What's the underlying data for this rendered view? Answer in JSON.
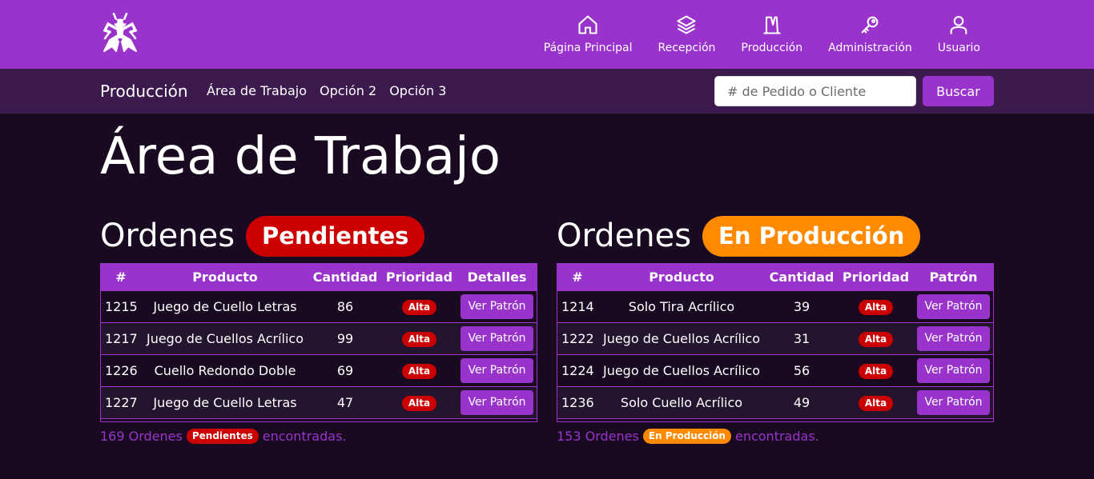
{
  "nav": [
    {
      "label": "Página Principal",
      "icon": "home-icon"
    },
    {
      "label": "Recepción",
      "icon": "layers-icon"
    },
    {
      "label": "Producción",
      "icon": "production-icon"
    },
    {
      "label": "Administración",
      "icon": "key-icon"
    },
    {
      "label": "Usuario",
      "icon": "user-icon"
    }
  ],
  "subbar": {
    "brand": "Producción",
    "links": [
      "Área de Trabajo",
      "Opción 2",
      "Opción 3"
    ],
    "search_placeholder": "# de Pedido o Cliente",
    "search_button": "Buscar"
  },
  "page_title": "Área de Trabajo",
  "colors": {
    "accent": "#9933cc",
    "pending": "#cc0000",
    "production": "#ff8a00",
    "background": "#190a22"
  },
  "pending": {
    "title": "Ordenes",
    "badge": "Pendientes",
    "columns": [
      "#",
      "Producto",
      "Cantidad",
      "Prioridad",
      "Detalles"
    ],
    "rows": [
      {
        "id": "1215",
        "product": "Juego de Cuello Letras",
        "qty": "86",
        "priority": "Alta",
        "action": "Ver Patrón"
      },
      {
        "id": "1217",
        "product": "Juego de Cuellos Acrílico",
        "qty": "99",
        "priority": "Alta",
        "action": "Ver Patrón"
      },
      {
        "id": "1226",
        "product": "Cuello Redondo Doble",
        "qty": "69",
        "priority": "Alta",
        "action": "Ver Patrón"
      },
      {
        "id": "1227",
        "product": "Juego de Cuello Letras",
        "qty": "47",
        "priority": "Alta",
        "action": "Ver Patrón"
      }
    ],
    "count_prefix": "169 Ordenes",
    "count_badge": "Pendientes",
    "count_suffix": "encontradas."
  },
  "production": {
    "title": "Ordenes",
    "badge": "En Producción",
    "columns": [
      "#",
      "Producto",
      "Cantidad",
      "Prioridad",
      "Patrón"
    ],
    "rows": [
      {
        "id": "1214",
        "product": "Solo Tira Acrílico",
        "qty": "39",
        "priority": "Alta",
        "action": "Ver Patrón"
      },
      {
        "id": "1222",
        "product": "Juego de Cuellos Acrílico",
        "qty": "31",
        "priority": "Alta",
        "action": "Ver Patrón"
      },
      {
        "id": "1224",
        "product": "Juego de Cuellos Acrílico",
        "qty": "56",
        "priority": "Alta",
        "action": "Ver Patrón"
      },
      {
        "id": "1236",
        "product": "Solo Cuello Acrílico",
        "qty": "49",
        "priority": "Alta",
        "action": "Ver Patrón"
      }
    ],
    "count_prefix": "153 Ordenes",
    "count_badge": "En Producción",
    "count_suffix": "encontradas."
  }
}
